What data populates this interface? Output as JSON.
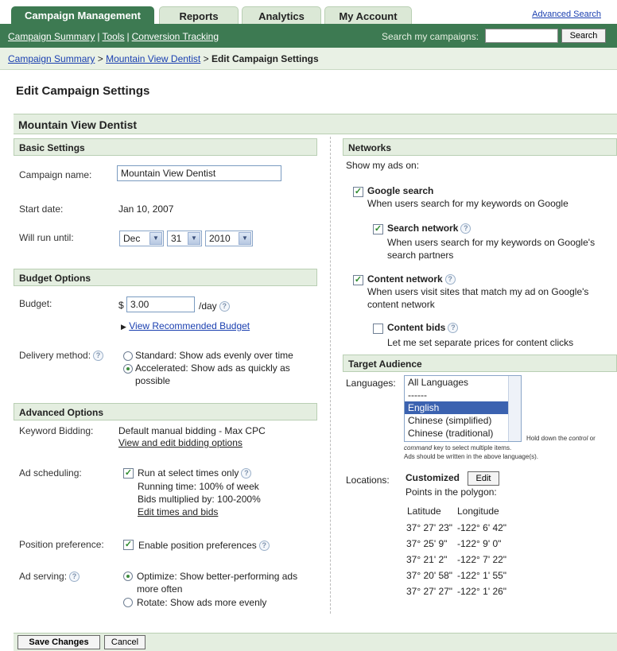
{
  "tabs": [
    {
      "label": "Campaign Management",
      "active": true
    },
    {
      "label": "Reports",
      "active": false
    },
    {
      "label": "Analytics",
      "active": false
    },
    {
      "label": "My Account",
      "active": false
    }
  ],
  "advanced_search": "Advanced Search",
  "subnav": {
    "links": [
      "Campaign Summary",
      "Tools",
      "Conversion Tracking"
    ],
    "search_label": "Search my campaigns:",
    "search_value": "",
    "search_button": "Search"
  },
  "breadcrumb": {
    "crumb1": "Campaign Summary",
    "crumb2": "Mountain View Dentist",
    "current": "Edit Campaign Settings",
    "sep": ">"
  },
  "page_title": "Edit Campaign Settings",
  "campaign_header": "Mountain View Dentist",
  "basic": {
    "title": "Basic Settings",
    "name_label": "Campaign name:",
    "name_value": "Mountain View Dentist",
    "start_label": "Start date:",
    "start_value": "Jan 10, 2007",
    "until_label": "Will run until:",
    "month": "Dec",
    "day": "31",
    "year": "2010"
  },
  "budget": {
    "title": "Budget Options",
    "budget_label": "Budget:",
    "currency": "$",
    "amount": "3.00",
    "per_day": "/day",
    "recommended_link": "View Recommended Budget",
    "delivery_label": "Delivery method:",
    "standard": "Standard: Show ads evenly over time",
    "accelerated_1": "Accelerated: Show ads as quickly as",
    "accelerated_2": "possible"
  },
  "advanced": {
    "title": "Advanced Options",
    "kb_label": "Keyword Bidding:",
    "kb_value": "Default manual bidding - Max CPC",
    "kb_link": "View and edit bidding options",
    "sched_label": "Ad scheduling:",
    "sched_check": "Run at select times only",
    "sched_running": "Running time: 100% of week",
    "sched_bids": "Bids multiplied by: 100-200%",
    "sched_link": "Edit times and bids",
    "pos_label": "Position preference:",
    "pos_check": "Enable position preferences",
    "serving_label": "Ad serving:",
    "optimize_1": "Optimize: Show better-performing ads",
    "optimize_2": "more often",
    "rotate": "Rotate: Show ads more evenly"
  },
  "networks": {
    "title": "Networks",
    "show_label": "Show my ads on:",
    "google_search": "Google search",
    "google_search_desc": "When users search for my keywords on Google",
    "search_network": "Search network",
    "search_network_desc_1": "When users search for my keywords on Google's",
    "search_network_desc_2": "search partners",
    "content_network": "Content network",
    "content_network_desc_1": "When users visit sites that match my ad on Google's",
    "content_network_desc_2": "content network",
    "content_bids": "Content bids",
    "content_bids_desc": "Let me set separate prices for content clicks"
  },
  "target": {
    "title": "Target Audience",
    "languages_label": "Languages:",
    "languages": [
      "All Languages",
      "------",
      "English",
      "Chinese (simplified)",
      "Chinese (traditional)"
    ],
    "selected_language": "English",
    "hint_line1_a": "Hold down the ",
    "hint_line1_b": "control",
    "hint_line1_c": " or",
    "hint_line2_a": "command",
    "hint_line2_b": " key to select multiple items.",
    "hint_line3": "Ads should be written in the above language(s).",
    "locations_label": "Locations:",
    "locations_value": "Customized",
    "edit_button": "Edit",
    "points_label": "Points in the polygon:",
    "lat_header": "Latitude",
    "lon_header": "Longitude",
    "points": [
      {
        "lat": "37° 27' 23\"",
        "lon": "-122° 6' 42\""
      },
      {
        "lat": "37° 25' 9\"",
        "lon": "-122° 9' 0\""
      },
      {
        "lat": "37° 21' 2\"",
        "lon": "-122° 7' 22\""
      },
      {
        "lat": "37° 20' 58\"",
        "lon": "-122° 1' 55\""
      },
      {
        "lat": "37° 27' 27\"",
        "lon": "-122° 1' 26\""
      }
    ]
  },
  "footer": {
    "save": "Save Changes",
    "cancel": "Cancel"
  }
}
